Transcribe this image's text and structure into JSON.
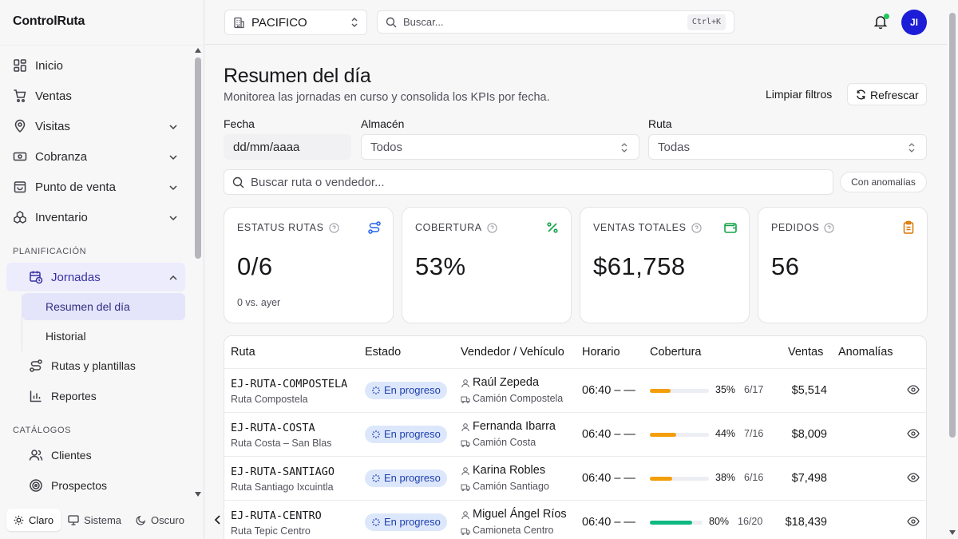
{
  "app": {
    "name": "ControlRuta"
  },
  "sidebar": {
    "items": [
      {
        "label": "Inicio"
      },
      {
        "label": "Ventas"
      },
      {
        "label": "Visitas"
      },
      {
        "label": "Cobranza"
      },
      {
        "label": "Punto de venta"
      },
      {
        "label": "Inventario"
      }
    ],
    "section_planning": "PLANIFICACIÓN",
    "jornadas": "Jornadas",
    "sub_items": [
      {
        "label": "Resumen del día"
      },
      {
        "label": "Historial"
      }
    ],
    "planning_items": [
      {
        "label": "Rutas y plantillas"
      },
      {
        "label": "Reportes"
      }
    ],
    "section_catalogs": "CATÁLOGOS",
    "catalog_items": [
      {
        "label": "Clientes"
      },
      {
        "label": "Prospectos"
      }
    ],
    "theme": {
      "light": "Claro",
      "system": "Sistema",
      "dark": "Oscuro"
    }
  },
  "topbar": {
    "warehouse": "PACIFICO",
    "search_placeholder": "Buscar...",
    "shortcut": "Ctrl+K",
    "avatar_initials": "JI"
  },
  "page": {
    "title": "Resumen del día",
    "subtitle": "Monitorea las jornadas en curso y consolida los KPIs por fecha.",
    "clear_filters": "Limpiar filtros",
    "refresh": "Refrescar"
  },
  "filters": {
    "date_label": "Fecha",
    "date_value": "dd/mm/aaaa",
    "warehouse_label": "Almacén",
    "warehouse_value": "Todos",
    "route_label": "Ruta",
    "route_value": "Todas",
    "search_placeholder": "Buscar ruta o vendedor...",
    "anomalies_button": "Con anomalías"
  },
  "kpis": [
    {
      "label": "ESTATUS RUTAS",
      "value": "0/6",
      "note": "0 vs. ayer",
      "icon": "route-icon",
      "color": "#2563eb"
    },
    {
      "label": "COBERTURA",
      "value": "53%",
      "note": "",
      "icon": "percent-icon",
      "color": "#16a34a"
    },
    {
      "label": "VENTAS TOTALES",
      "value": "$61,758",
      "note": "",
      "icon": "wallet-icon",
      "color": "#16a34a"
    },
    {
      "label": "PEDIDOS",
      "value": "56",
      "note": "",
      "icon": "clipboard-icon",
      "color": "#d97706"
    }
  ],
  "table": {
    "headers": [
      "Ruta",
      "Estado",
      "Vendedor / Vehículo",
      "Horario",
      "Cobertura",
      "Ventas",
      "Anomalías"
    ],
    "rows": [
      {
        "code": "EJ-RUTA-COMPOSTELA",
        "name": "Ruta Compostela",
        "status": "En progreso",
        "seller": "Raúl Zepeda",
        "vehicle": "Camión Compostela",
        "schedule": "06:40 – —",
        "coverage": 0.35,
        "coverage_pct": "35%",
        "coverage_frac": "6/17",
        "sales": "$5,514"
      },
      {
        "code": "EJ-RUTA-COSTA",
        "name": "Ruta Costa – San Blas",
        "status": "En progreso",
        "seller": "Fernanda Ibarra",
        "vehicle": "Camión Costa",
        "schedule": "06:40 – —",
        "coverage": 0.44,
        "coverage_pct": "44%",
        "coverage_frac": "7/16",
        "sales": "$8,009"
      },
      {
        "code": "EJ-RUTA-SANTIAGO",
        "name": "Ruta Santiago Ixcuintla",
        "status": "En progreso",
        "seller": "Karina Robles",
        "vehicle": "Camión Santiago",
        "schedule": "06:40 – —",
        "coverage": 0.38,
        "coverage_pct": "38%",
        "coverage_frac": "6/16",
        "sales": "$7,498"
      },
      {
        "code": "EJ-RUTA-CENTRO",
        "name": "Ruta Tepic Centro",
        "status": "En progreso",
        "seller": "Miguel Ángel Ríos",
        "vehicle": "Camioneta Centro",
        "schedule": "06:40 – —",
        "coverage": 0.8,
        "coverage_pct": "80%",
        "coverage_frac": "16/20",
        "sales": "$18,439"
      }
    ]
  },
  "colors": {
    "accent": "#3730a3",
    "low_coverage": "#f59e0b",
    "high_coverage": "#10b981",
    "badge_bg": "#dde7fb",
    "avatar": "#1d1dd8"
  }
}
